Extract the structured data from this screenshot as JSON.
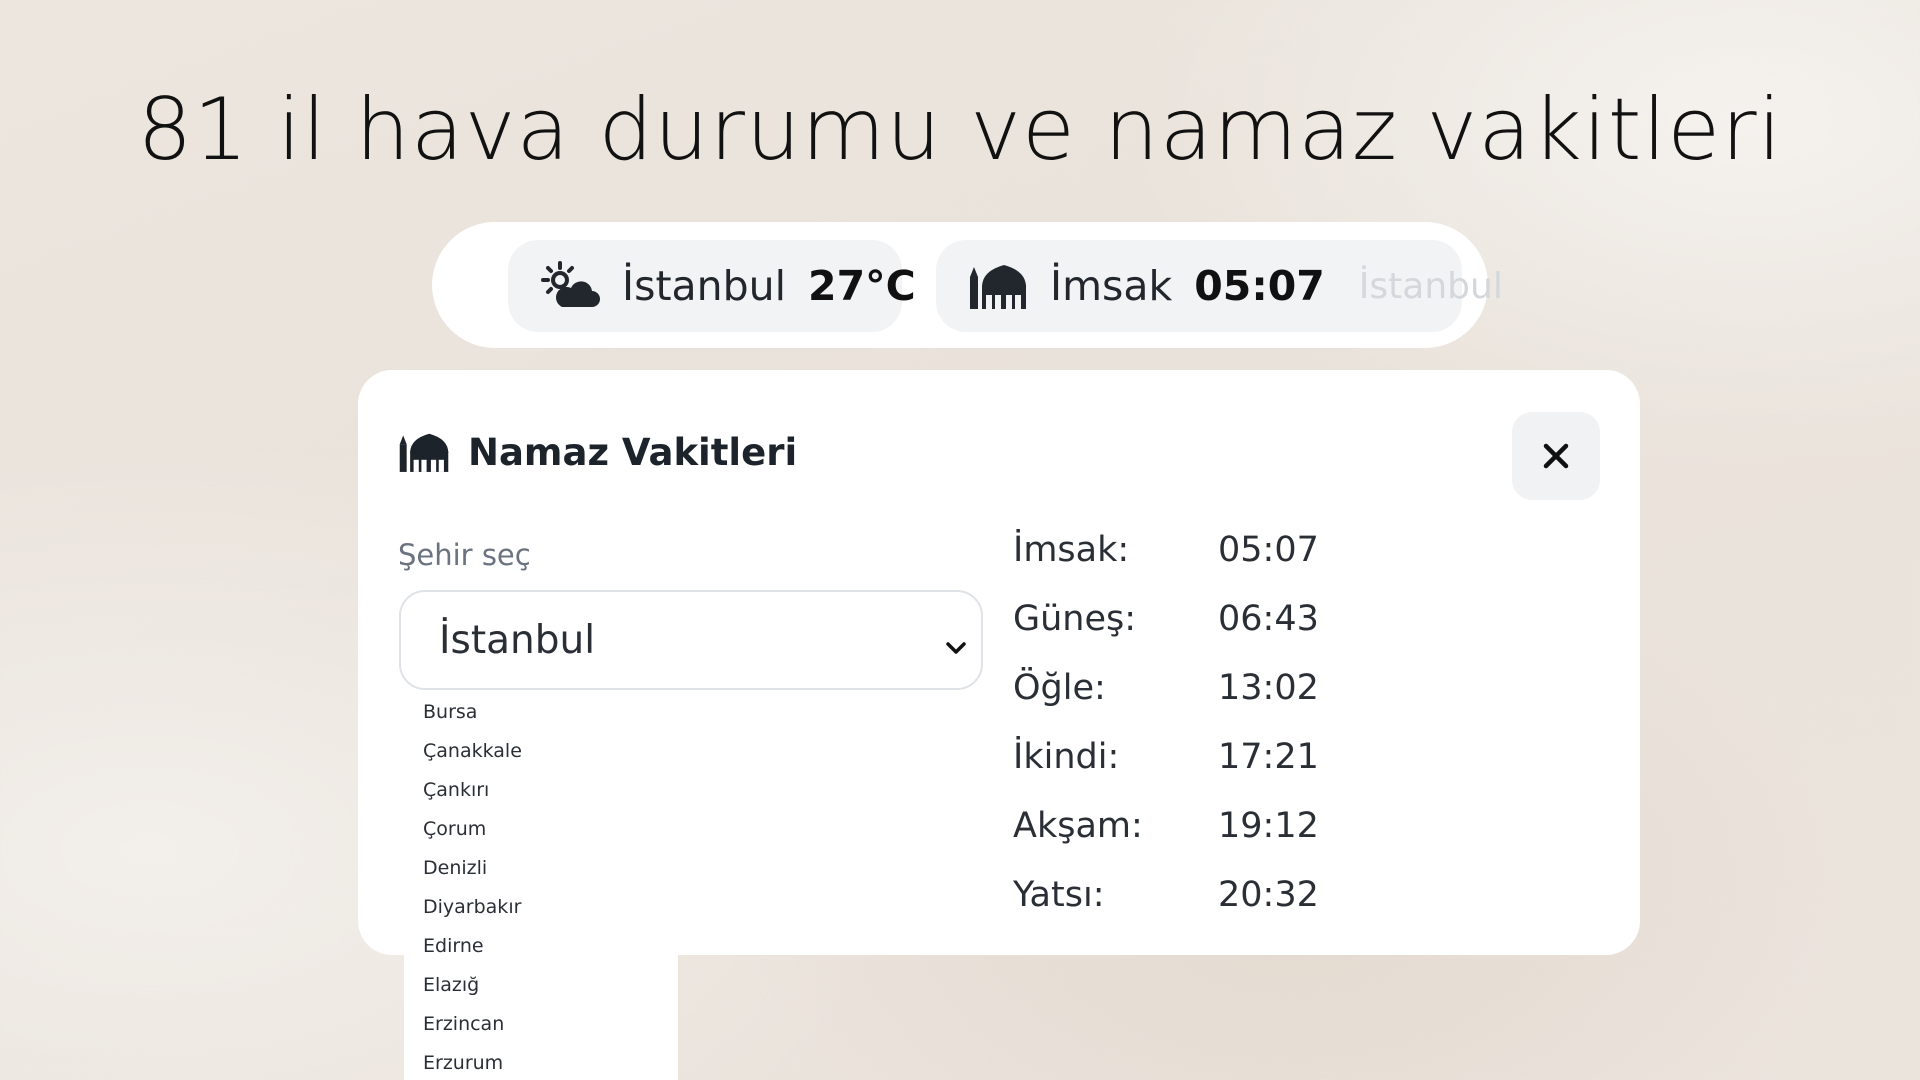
{
  "headline": "81 il hava durumu ve namaz vakitleri",
  "topbar": {
    "weather": {
      "icon": "sun-behind-cloud-icon",
      "city": "İstanbul",
      "temperature": "27°C"
    },
    "prayer": {
      "icon": "mosque-icon",
      "name": "İmsak",
      "time": "05:07",
      "city": "İstanbul"
    }
  },
  "modal": {
    "icon": "mosque-icon",
    "title": "Namaz Vakitleri",
    "close_icon": "close-icon",
    "city_label": "Şehir seç",
    "selected_city": "İstanbul",
    "times": [
      {
        "label": "İmsak:",
        "value": "05:07"
      },
      {
        "label": "Güneş:",
        "value": "06:43"
      },
      {
        "label": "Öğle:",
        "value": "13:02"
      },
      {
        "label": "İkindi:",
        "value": "17:21"
      },
      {
        "label": "Akşam:",
        "value": "19:12"
      },
      {
        "label": "Yatsı:",
        "value": "20:32"
      }
    ]
  },
  "dropdown": {
    "options": [
      "Bursa",
      "Çanakkale",
      "Çankırı",
      "Çorum",
      "Denizli",
      "Diyarbakır",
      "Edirne",
      "Elazığ",
      "Erzincan",
      "Erzurum"
    ]
  },
  "colors": {
    "text_dark": "#1f2328",
    "muted": "#6b7280",
    "pill_bg": "#f2f3f5"
  }
}
